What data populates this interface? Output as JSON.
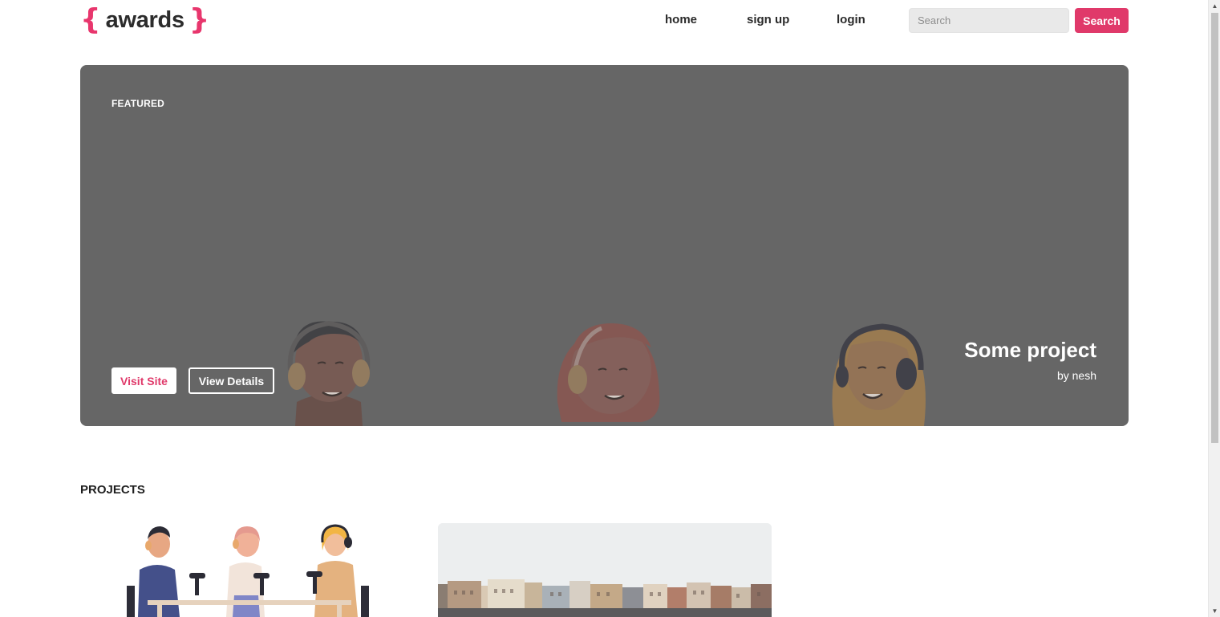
{
  "header": {
    "logo": {
      "brace_open": "{",
      "word": "awards",
      "brace_close": "}"
    },
    "nav": {
      "home": "home",
      "sign_up": "sign up",
      "login": "login"
    },
    "search": {
      "placeholder": "Search",
      "value": "",
      "button_label": "Search"
    }
  },
  "hero": {
    "badge": "FEATURED",
    "visit_label": "Visit Site",
    "details_label": "View Details",
    "title": "Some project",
    "author": "by nesh"
  },
  "projects": {
    "heading": "PROJECTS",
    "cards": [
      {
        "image": "podcast-illustration"
      },
      {
        "image": "city-waterfront-photo"
      }
    ]
  },
  "colors": {
    "accent": "#e0396a",
    "hero_bg": "#666666",
    "text_dark": "#2a2a2a"
  }
}
